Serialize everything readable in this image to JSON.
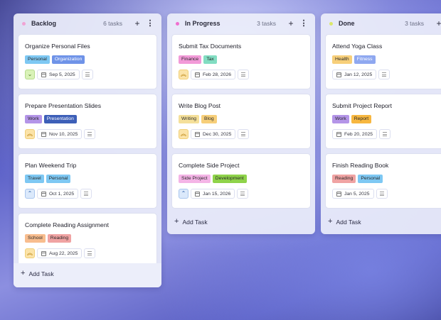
{
  "columns": [
    {
      "title": "Backlog",
      "count": "6 tasks",
      "dot_color": "#f0a3d4",
      "add_task": "Add Task",
      "cards": [
        {
          "title": "Organize Personal Files",
          "tags": [
            {
              "label": "Personal",
              "color": "#7ec8f3"
            },
            {
              "label": "Organization",
              "color": "#6f93e8"
            }
          ],
          "priority": "low",
          "priority_icon": "chevron-down-icon",
          "date": "Sep 5, 2025"
        },
        {
          "title": "Prepare Presentation Slides",
          "tags": [
            {
              "label": "Work",
              "color": "#b495e8"
            },
            {
              "label": "Presentation",
              "color": "#3d5fb8"
            }
          ],
          "priority": "high",
          "priority_icon": "double-chevron-up-icon",
          "date": "Nov 10, 2025"
        },
        {
          "title": "Plan Weekend Trip",
          "tags": [
            {
              "label": "Travel",
              "color": "#7ec8f3"
            },
            {
              "label": "Personal",
              "color": "#7ec8f3"
            }
          ],
          "priority": "medium",
          "priority_icon": "chevron-up-icon",
          "date": "Oct 1, 2025"
        },
        {
          "title": "Complete Reading Assignment",
          "tags": [
            {
              "label": "School",
              "color": "#f8bd8e"
            },
            {
              "label": "Reading",
              "color": "#f0a3a3"
            }
          ],
          "priority": "high",
          "priority_icon": "double-chevron-up-icon",
          "date": "Aug 22, 2025"
        }
      ]
    },
    {
      "title": "In Progress",
      "count": "3 tasks",
      "dot_color": "#f06fcf",
      "add_task": "Add Task",
      "cards": [
        {
          "title": "Submit Tax Documents",
          "tags": [
            {
              "label": "Finance",
              "color": "#f29ad8"
            },
            {
              "label": "Tax",
              "color": "#82ddc2"
            }
          ],
          "priority": "high",
          "priority_icon": "double-chevron-up-icon",
          "date": "Feb 28, 2026"
        },
        {
          "title": "Write Blog Post",
          "tags": [
            {
              "label": "Writing",
              "color": "#f5e09a"
            },
            {
              "label": "Blog",
              "color": "#f7cf7a"
            }
          ],
          "priority": "high",
          "priority_icon": "double-chevron-up-icon",
          "date": "Dec 30, 2025"
        },
        {
          "title": "Complete Side Project",
          "tags": [
            {
              "label": "Side Project",
              "color": "#f4b4e6"
            },
            {
              "label": "Development",
              "color": "#8fd34a"
            }
          ],
          "priority": "medium",
          "priority_icon": "chevron-up-icon",
          "date": "Jan 15, 2026"
        }
      ]
    },
    {
      "title": "Done",
      "count": "3 tasks",
      "dot_color": "#dbe86a",
      "add_task": "Add Task",
      "cards": [
        {
          "title": "Attend Yoga Class",
          "tags": [
            {
              "label": "Health",
              "color": "#f7cf7a"
            },
            {
              "label": "Fitness",
              "color": "#8fa8f0"
            }
          ],
          "priority": "none",
          "date": "Jan 12, 2025"
        },
        {
          "title": "Submit Project Report",
          "tags": [
            {
              "label": "Work",
              "color": "#b495e8"
            },
            {
              "label": "Report",
              "color": "#f7b740"
            }
          ],
          "priority": "none",
          "date": "Feb 20, 2025"
        },
        {
          "title": "Finish Reading Book",
          "tags": [
            {
              "label": "Reading",
              "color": "#f0a3a3"
            },
            {
              "label": "Personal",
              "color": "#7ec8f3"
            }
          ],
          "priority": "none",
          "date": "Jan 5, 2025"
        }
      ]
    }
  ]
}
